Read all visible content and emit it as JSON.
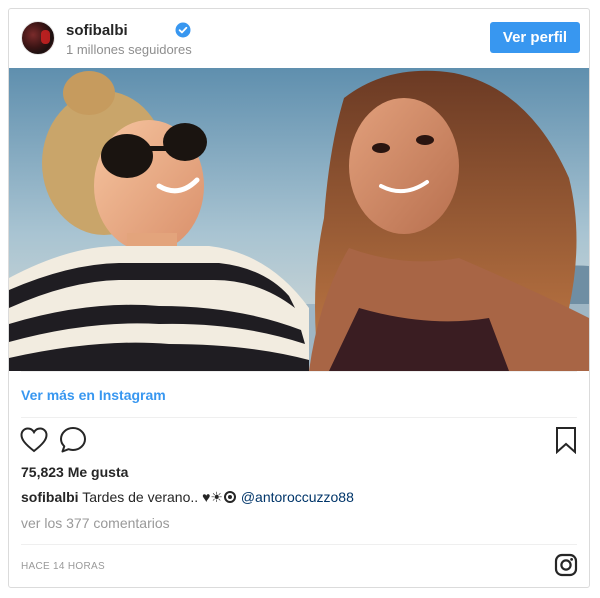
{
  "header": {
    "username": "sofibalbi",
    "followers": "1 millones seguidores",
    "profile_button": "Ver perfil",
    "verified_icon": "verified-badge-icon",
    "accent": "#3897f0"
  },
  "post": {
    "view_more": "Ver más en Instagram",
    "likes": "75,823 Me gusta",
    "caption_user": "sofibalbi",
    "caption_text": "Tardes de verano..",
    "caption_emoji": "♥☀",
    "mention": "@antoroccuzzo88",
    "comments_link": "ver los 377 comentarios",
    "timestamp": "HACE 14 HORAS"
  },
  "icons": {
    "like": "heart-icon",
    "comment": "comment-icon",
    "save": "bookmark-icon",
    "brand": "instagram-logo-icon"
  }
}
